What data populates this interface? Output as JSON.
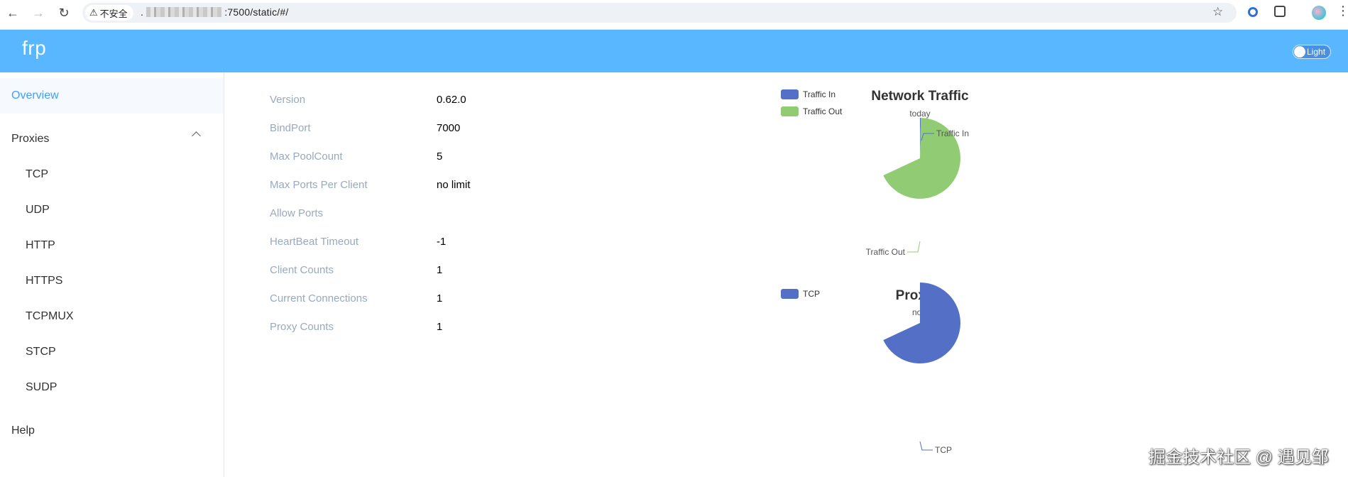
{
  "browser": {
    "security_label": "不安全",
    "url_prefix": ".",
    "url_suffix": ":7500/static/#/"
  },
  "app": {
    "brand": "frp",
    "theme_toggle_label": "Light"
  },
  "sidebar": {
    "items": [
      {
        "label": "Overview",
        "active": true
      },
      {
        "label": "Proxies",
        "expanded": true
      },
      {
        "label": "TCP"
      },
      {
        "label": "UDP"
      },
      {
        "label": "HTTP"
      },
      {
        "label": "HTTPS"
      },
      {
        "label": "TCPMUX"
      },
      {
        "label": "STCP"
      },
      {
        "label": "SUDP"
      },
      {
        "label": "Help"
      }
    ]
  },
  "server_info": [
    {
      "label": "Version",
      "value": "0.62.0"
    },
    {
      "label": "BindPort",
      "value": "7000"
    },
    {
      "label": "Max PoolCount",
      "value": "5"
    },
    {
      "label": "Max Ports Per Client",
      "value": "no limit"
    },
    {
      "label": "Allow Ports",
      "value": ""
    },
    {
      "label": "HeartBeat Timeout",
      "value": "-1"
    },
    {
      "label": "Client Counts",
      "value": "1"
    },
    {
      "label": "Current Connections",
      "value": "1"
    },
    {
      "label": "Proxy Counts",
      "value": "1"
    }
  ],
  "chart_data": [
    {
      "type": "pie",
      "title": "Network Traffic",
      "subtitle": "today",
      "categories": [
        "Traffic In",
        "Traffic Out"
      ],
      "values": [
        0.5,
        99.5
      ],
      "colors": [
        "#5470c6",
        "#91cc75"
      ],
      "legend_position": "top-left"
    },
    {
      "type": "pie",
      "title": "Proxies",
      "subtitle": "now",
      "categories": [
        "TCP"
      ],
      "values": [
        1
      ],
      "colors": [
        "#5470c6"
      ],
      "legend_position": "top-left"
    }
  ],
  "watermark": "掘金技术社区 @ 遇见邹",
  "icons": {
    "back": "arrow-left-icon",
    "forward": "arrow-right-icon",
    "reload": "reload-icon",
    "warning": "warning-icon",
    "bookmark": "star-icon",
    "extension": "puzzle-icon",
    "menu": "kebab-icon"
  }
}
